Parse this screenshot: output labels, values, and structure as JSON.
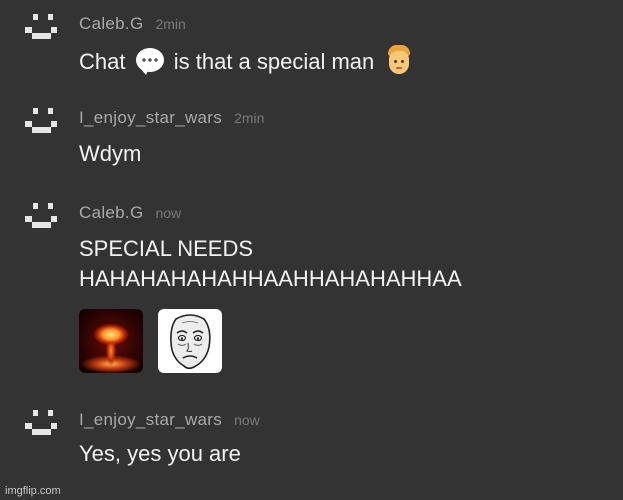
{
  "messages": [
    {
      "username": "Caleb.G",
      "time": "2min",
      "text_before": "Chat",
      "text_after": "is that a special man",
      "inline_icons": [
        "speech-bubble-icon",
        "blond-man-face-icon"
      ]
    },
    {
      "username": "I_enjoy_star_wars",
      "time": "2min",
      "text": "Wdym"
    },
    {
      "username": "Caleb.G",
      "time": "now",
      "line1": "SPECIAL NEEDS",
      "line2": "HAHAHAHAHAHHAAHHAHAHAHHAA",
      "attachments": [
        "nuclear-explosion-image",
        "okay-face-meme-image"
      ]
    },
    {
      "username": "I_enjoy_star_wars",
      "time": "now",
      "text": "Yes, yes you are"
    }
  ],
  "watermark": "imgflip.com",
  "colors": {
    "background": "#333333",
    "username": "#a9a9a9",
    "timestamp": "#7a7a7a",
    "message_text": "#f2f2f2",
    "avatar": "#e6e6e6"
  }
}
